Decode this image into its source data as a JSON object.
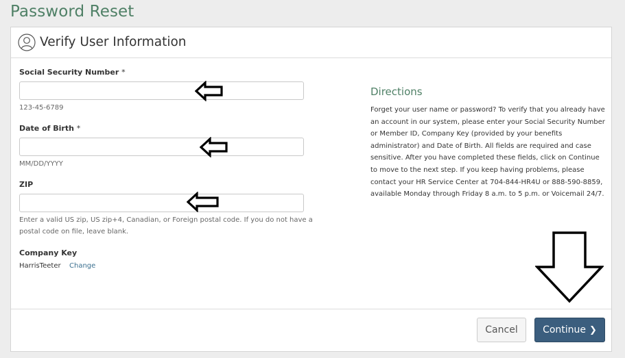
{
  "page": {
    "title": "Password Reset"
  },
  "panel": {
    "title": "Verify User Information",
    "icon": "user-circle-icon"
  },
  "form": {
    "ssn": {
      "label": "Social Security Number",
      "required_mark": "*",
      "value": "",
      "hint": "123-45-6789"
    },
    "dob": {
      "label": "Date of Birth",
      "required_mark": "*",
      "value": "",
      "hint": "MM/DD/YYYY"
    },
    "zip": {
      "label": "ZIP",
      "value": "",
      "hint": "Enter a valid US zip, US zip+4, Canadian, or Foreign postal code. If you do not have a postal code on file, leave blank."
    },
    "company_key": {
      "label": "Company Key",
      "value": "HarrisTeeter",
      "change_label": "Change"
    }
  },
  "directions": {
    "title": "Directions",
    "text": "Forget your user name or password? To verify that you already have an account in our system, please enter your Social Security Number or Member ID, Company Key (provided by your benefits administrator) and Date of Birth. All fields are required and case sensitive. After you have completed these fields, click on Continue to move to the next step. If you keep having problems, please contact your HR Service Center at 704-844-HR4U or 888-590-8859, available Monday through Friday 8 a.m. to 5 p.m. or Voicemail 24/7."
  },
  "buttons": {
    "cancel_label": "Cancel",
    "continue_label": "Continue",
    "continue_icon": "chevron-right-icon"
  },
  "annotations": {
    "arrow_icon": "left-arrow-icon",
    "down_arrow_icon": "down-arrow-icon"
  },
  "colors": {
    "brand_green": "#4f8066",
    "continue_blue": "#3b5e7e",
    "link_blue": "#3a6f8f"
  }
}
